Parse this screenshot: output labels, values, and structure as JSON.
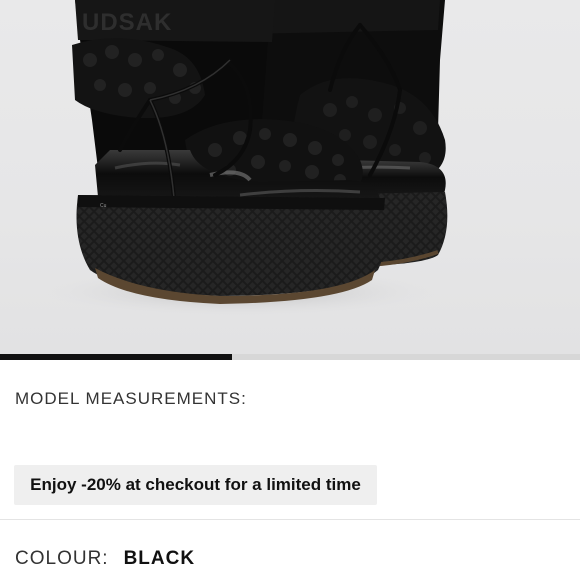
{
  "product": {
    "gallery": {
      "image_alt": "Black shearling snow boots with patent leather toe and textured platform sole",
      "brand_mark": "UDSAK",
      "progress_fraction": 0.4
    },
    "measurements_label": "MODEL MEASUREMENTS:",
    "promo_text": "Enjoy -20% at checkout for a limited time",
    "colour": {
      "label": "COLOUR:",
      "value": "BLACK"
    }
  }
}
